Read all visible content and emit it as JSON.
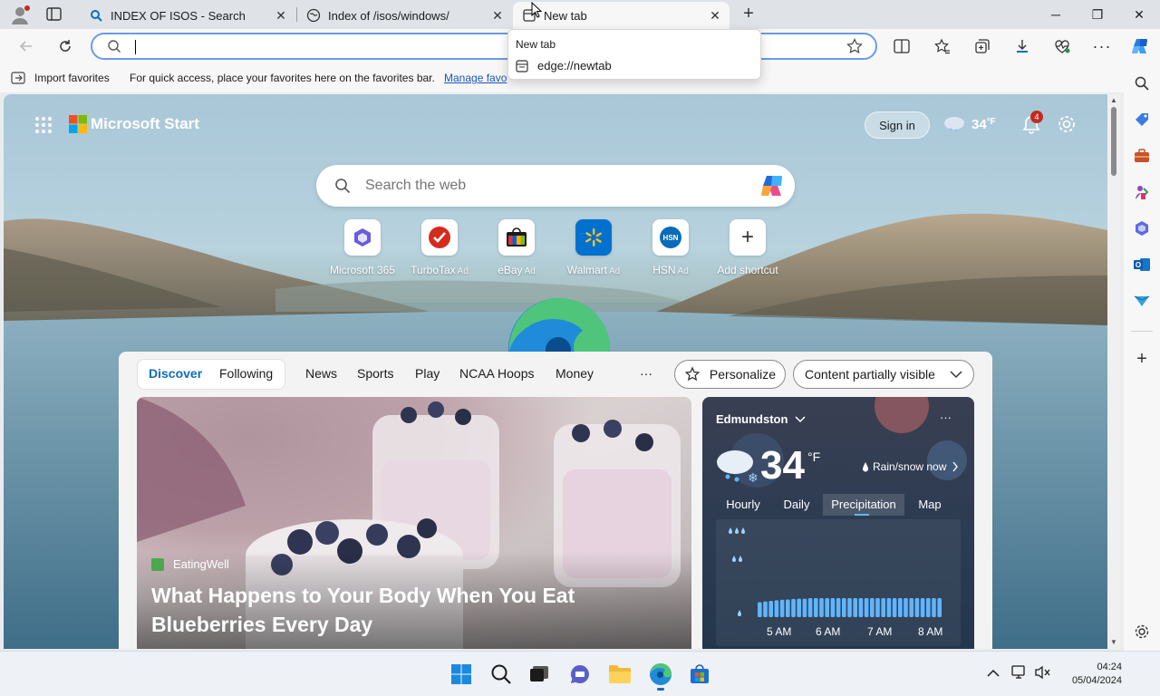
{
  "tabs": [
    {
      "title": "INDEX OF ISOS - Search",
      "icon": "search-icon"
    },
    {
      "title": "Index of /isos/windows/",
      "icon": "site-icon"
    },
    {
      "title": "New tab",
      "icon": "newtab-icon",
      "active": true
    }
  ],
  "address": {
    "value": "",
    "placeholder": ""
  },
  "dropdown": {
    "title": "New tab",
    "url": "edge://newtab"
  },
  "favorites_bar": {
    "import_label": "Import favorites",
    "hint": "For quick access, place your favorites here on the favorites bar.",
    "manage_label": "Manage favo"
  },
  "ms_start": {
    "brand": "Microsoft Start",
    "sign_in": "Sign in",
    "temp": "34",
    "temp_unit": "°F",
    "notification_count": "4",
    "search_placeholder": "Search the web"
  },
  "shortcuts": [
    {
      "label": "Microsoft 365",
      "ad": ""
    },
    {
      "label": "TurboTax",
      "ad": "Ad"
    },
    {
      "label": "eBay",
      "ad": "Ad"
    },
    {
      "label": "Walmart",
      "ad": "Ad"
    },
    {
      "label": "HSN",
      "ad": "Ad"
    },
    {
      "label": "Add shortcut",
      "ad": ""
    }
  ],
  "feed": {
    "pill_tabs": [
      "Discover",
      "Following"
    ],
    "tabs": [
      "News",
      "Sports",
      "Play",
      "NCAA Hoops",
      "Money"
    ],
    "more": "···",
    "personalize": "Personalize",
    "content_visibility": "Content partially visible",
    "hero": {
      "source": "EatingWell",
      "headline": "What Happens to Your Body When You Eat Blueberries Every Day"
    }
  },
  "weather": {
    "location": "Edmundston",
    "temp": "34",
    "unit": "°F",
    "condition": "Rain/snow now",
    "tabs": [
      "Hourly",
      "Daily",
      "Precipitation",
      "Map"
    ],
    "active_tab": "Precipitation",
    "times": [
      "5 AM",
      "6 AM",
      "7 AM",
      "8 AM"
    ]
  },
  "precip_levels": [
    0.55,
    0.58,
    0.6,
    0.62,
    0.64,
    0.65,
    0.67,
    0.68,
    0.68,
    0.7,
    0.7,
    0.7,
    0.7,
    0.7,
    0.7,
    0.7,
    0.7,
    0.7,
    0.7,
    0.7,
    0.7,
    0.7,
    0.7,
    0.7,
    0.7,
    0.7,
    0.7,
    0.7,
    0.7,
    0.7,
    0.7,
    0.7,
    0.7
  ],
  "clock": {
    "time": "04:24",
    "date": "05/04/2024"
  },
  "colors": {
    "accent": "#0f6cbd",
    "edge": "#1f8bd9",
    "turbotax": "#d52b1e",
    "walmart": "#0071ce",
    "hsn": "#0a6cb8"
  }
}
